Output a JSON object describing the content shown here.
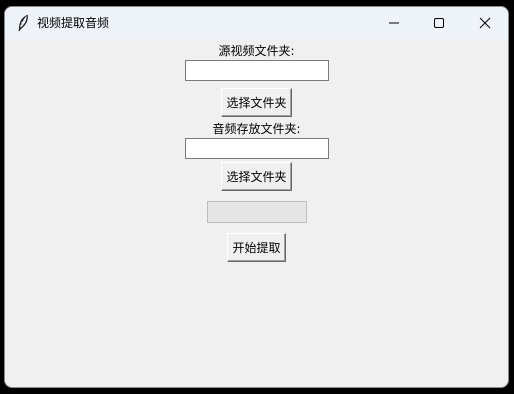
{
  "window": {
    "title": "视频提取音频",
    "icon": "feather-icon"
  },
  "controls": {
    "minimize_icon": "minimize-icon",
    "maximize_icon": "maximize-icon",
    "close_icon": "close-icon"
  },
  "form": {
    "source_label": "源视频文件夹:",
    "source_value": "",
    "source_button": "选择文件夹",
    "output_label": "音频存放文件夹:",
    "output_value": "",
    "output_button": "选择文件夹",
    "progress_percent": 0,
    "start_button": "开始提取"
  },
  "colors": {
    "background": "#f0f0f0",
    "titlebar": "#eef3f9",
    "entry": "#ffffff"
  }
}
